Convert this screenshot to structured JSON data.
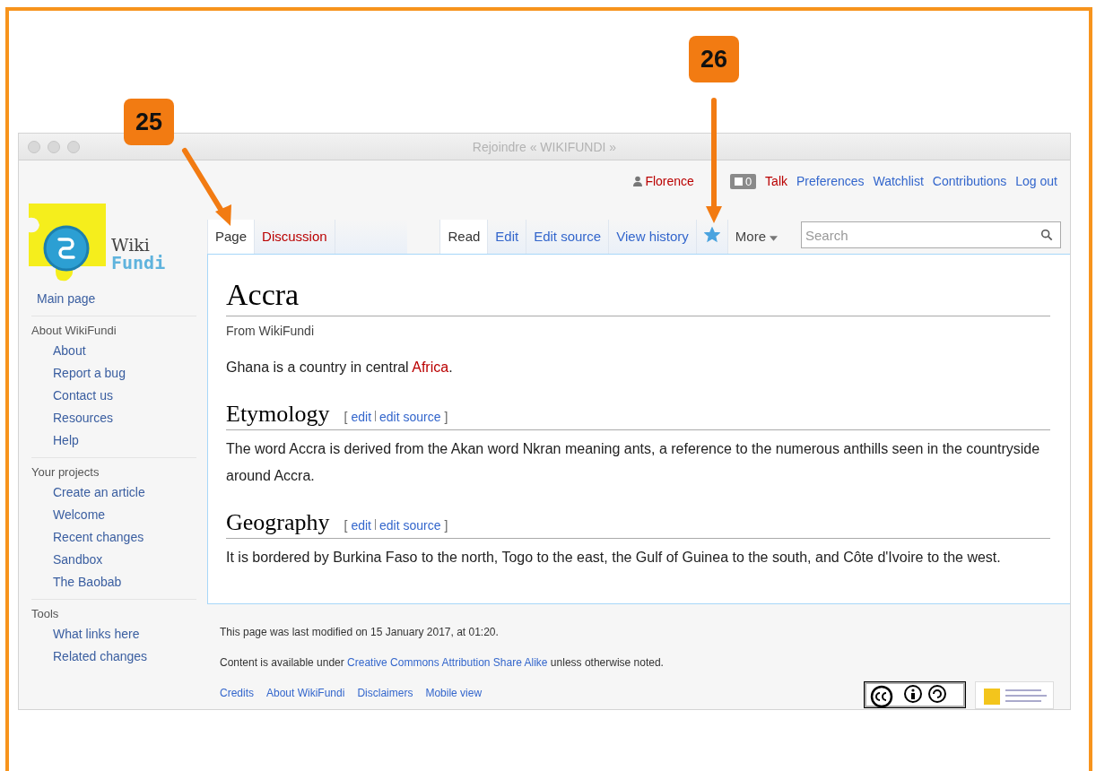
{
  "callouts": [
    {
      "number": "25"
    },
    {
      "number": "26"
    }
  ],
  "window": {
    "title": "Rejoindre « WIKIFUNDI »"
  },
  "logo": {
    "line1": "Wiki",
    "line2": "Fundi"
  },
  "personal_bar": {
    "user": "Florence",
    "notifications": "0",
    "links": [
      {
        "label": "Talk",
        "missing": true
      },
      {
        "label": "Preferences",
        "missing": false
      },
      {
        "label": "Watchlist",
        "missing": false
      },
      {
        "label": "Contributions",
        "missing": false
      },
      {
        "label": "Log out",
        "missing": false
      }
    ]
  },
  "namespace_tabs": [
    {
      "label": "Page",
      "selected": true,
      "missing": false
    },
    {
      "label": "Discussion",
      "selected": false,
      "missing": true
    }
  ],
  "view_tabs": [
    {
      "label": "Read",
      "selected": true
    },
    {
      "label": "Edit",
      "selected": false
    },
    {
      "label": "Edit source",
      "selected": false
    },
    {
      "label": "View history",
      "selected": false
    }
  ],
  "watch": {
    "on": true
  },
  "more_menu": {
    "label": "More"
  },
  "search": {
    "placeholder": "Search"
  },
  "article": {
    "title": "Accra",
    "tagline": "From WikiFundi",
    "intro": {
      "before": "Ghana is a country in central ",
      "link": "Africa",
      "after": "."
    },
    "sections": [
      {
        "heading": "Etymology",
        "open": "[",
        "edit": "edit",
        "edit_source": "edit source",
        "close": "]",
        "text": "The word Accra is derived from the Akan word Nkran meaning ants, a reference to the numerous anthills seen in the countryside around Accra."
      },
      {
        "heading": "Geography",
        "open": "[",
        "edit": "edit",
        "edit_source": "edit source",
        "close": "]",
        "text": "It is bordered by Burkina Faso to the north, Togo to the east, the Gulf of Guinea to the south, and Côte d'Ivoire to the west."
      }
    ]
  },
  "sidebar": {
    "main": "Main page",
    "sections": [
      {
        "title": "About WikiFundi",
        "items": [
          "About",
          "Report a bug",
          "Contact us",
          "Resources",
          "Help"
        ]
      },
      {
        "title": "Your projects",
        "items": [
          "Create an article",
          "Welcome",
          "Recent changes",
          "Sandbox",
          "The Baobab"
        ]
      },
      {
        "title": "Tools",
        "items": [
          "What links here",
          "Related changes"
        ]
      }
    ]
  },
  "footer": {
    "last_modified": "This page was last modified on 15 January 2017, at 01:20.",
    "license": {
      "before": "Content is available under ",
      "link": "Creative Commons Attribution Share Alike",
      "after": " unless otherwise noted."
    },
    "links": [
      "Credits",
      "About WikiFundi",
      "Disclaimers",
      "Mobile view"
    ]
  }
}
